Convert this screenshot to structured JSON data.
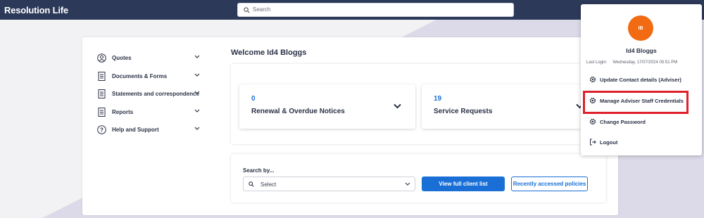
{
  "header": {
    "brand": "Resolution Life",
    "search_placeholder": "Search"
  },
  "sidebar": {
    "items": [
      {
        "label": "Quotes",
        "icon": "user-circle-icon"
      },
      {
        "label": "Documents & Forms",
        "icon": "document-icon"
      },
      {
        "label": "Statements and correspondence",
        "icon": "document-icon"
      },
      {
        "label": "Reports",
        "icon": "document-icon"
      },
      {
        "label": "Help and Support",
        "icon": "question-circle-icon"
      }
    ]
  },
  "main": {
    "welcome": "Welcome Id4 Bloggs",
    "cards": [
      {
        "count": "0",
        "label": "Renewal & Overdue Notices"
      },
      {
        "count": "19",
        "label": "Service Requests"
      }
    ],
    "search_by_label": "Search by...",
    "select_value": "Select",
    "view_button": "View full client list",
    "recent_button": "Recently accessed policies"
  },
  "profile_menu": {
    "initials": "IB",
    "name": "Id4 Bloggs",
    "last_login_label": "Last Login:",
    "last_login_value": "Wednesday, 17/07/2024 05:51 PM",
    "items": [
      {
        "label": "Update Contact details (Adviser)",
        "icon": "gear-icon"
      },
      {
        "label": "Manage Adviser Staff Credentials",
        "icon": "gear-icon"
      },
      {
        "label": "Change Password",
        "icon": "gear-icon"
      },
      {
        "label": "Logout",
        "icon": "logout-icon"
      }
    ]
  },
  "colors": {
    "header_bg": "#2d3958",
    "accent": "#1a6fd6",
    "avatar": "#f26a12",
    "highlight": "#e0202a"
  }
}
